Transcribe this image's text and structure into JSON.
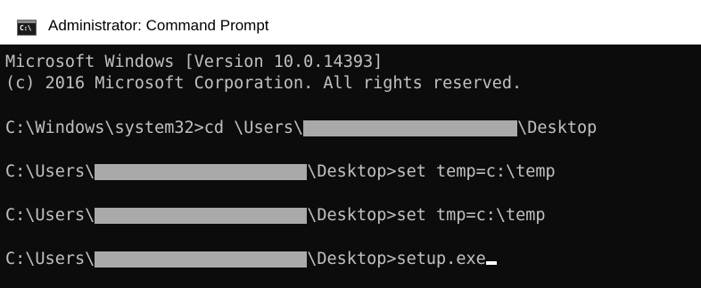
{
  "window": {
    "title": "Administrator: Command Prompt",
    "icon": "command-prompt-icon",
    "icon_glyph": "C:\\",
    "colors": {
      "background": "#0c0c0c",
      "text": "#c0c0c0",
      "redaction": "#a9a9a9",
      "titlebar": "#ffffff"
    }
  },
  "console": {
    "lines": [
      {
        "text": "Microsoft Windows [Version 10.0.14393]"
      },
      {
        "text": "(c) 2016 Microsoft Corporation. All rights reserved."
      },
      {
        "prefix": "C:\\Windows\\system32>cd \\Users\\",
        "suffix": "\\Desktop"
      },
      {
        "prefix": "C:\\Users\\",
        "suffix": "\\Desktop>set temp=c:\\temp"
      },
      {
        "prefix": "C:\\Users\\",
        "suffix": "\\Desktop>set tmp=c:\\temp"
      },
      {
        "prefix": "C:\\Users\\",
        "suffix": "\\Desktop>setup.exe"
      }
    ]
  }
}
